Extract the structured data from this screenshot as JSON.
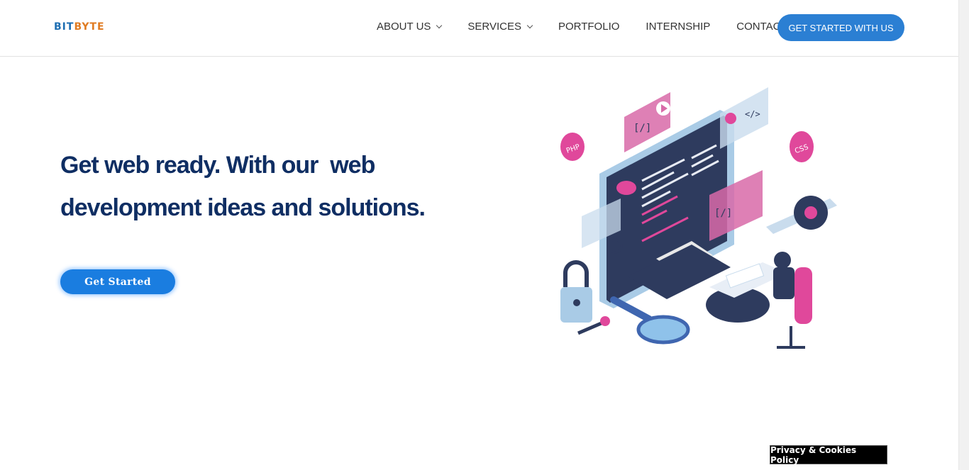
{
  "header": {
    "logo_part1": "BIT",
    "logo_part2": "BYTE",
    "nav": [
      {
        "label": "ABOUT US",
        "dropdown": true
      },
      {
        "label": "SERVICES",
        "dropdown": true
      },
      {
        "label": "PORTFOLIO",
        "dropdown": false
      },
      {
        "label": "INTERNSHIP",
        "dropdown": false
      },
      {
        "label": "CONTACT",
        "dropdown": false
      }
    ],
    "cta_label": "GET STARTED WITH US"
  },
  "hero": {
    "headline_line1": "Get web ready. With our  web",
    "headline_line2": "development ideas and solutions.",
    "button_label": "Get Started",
    "illustration_text": {
      "php": "PHP",
      "css": "CSS",
      "code_tag": "</>",
      "bracket_tag": "[/]"
    }
  },
  "footer": {
    "privacy_label": "Privacy & Cookies Policy"
  },
  "colors": {
    "primary": "#2b7fd3",
    "headline": "#0f2e63",
    "accent_pink": "#e0489b",
    "logo_blue": "#1f6fb2",
    "logo_orange": "#e07b22"
  }
}
